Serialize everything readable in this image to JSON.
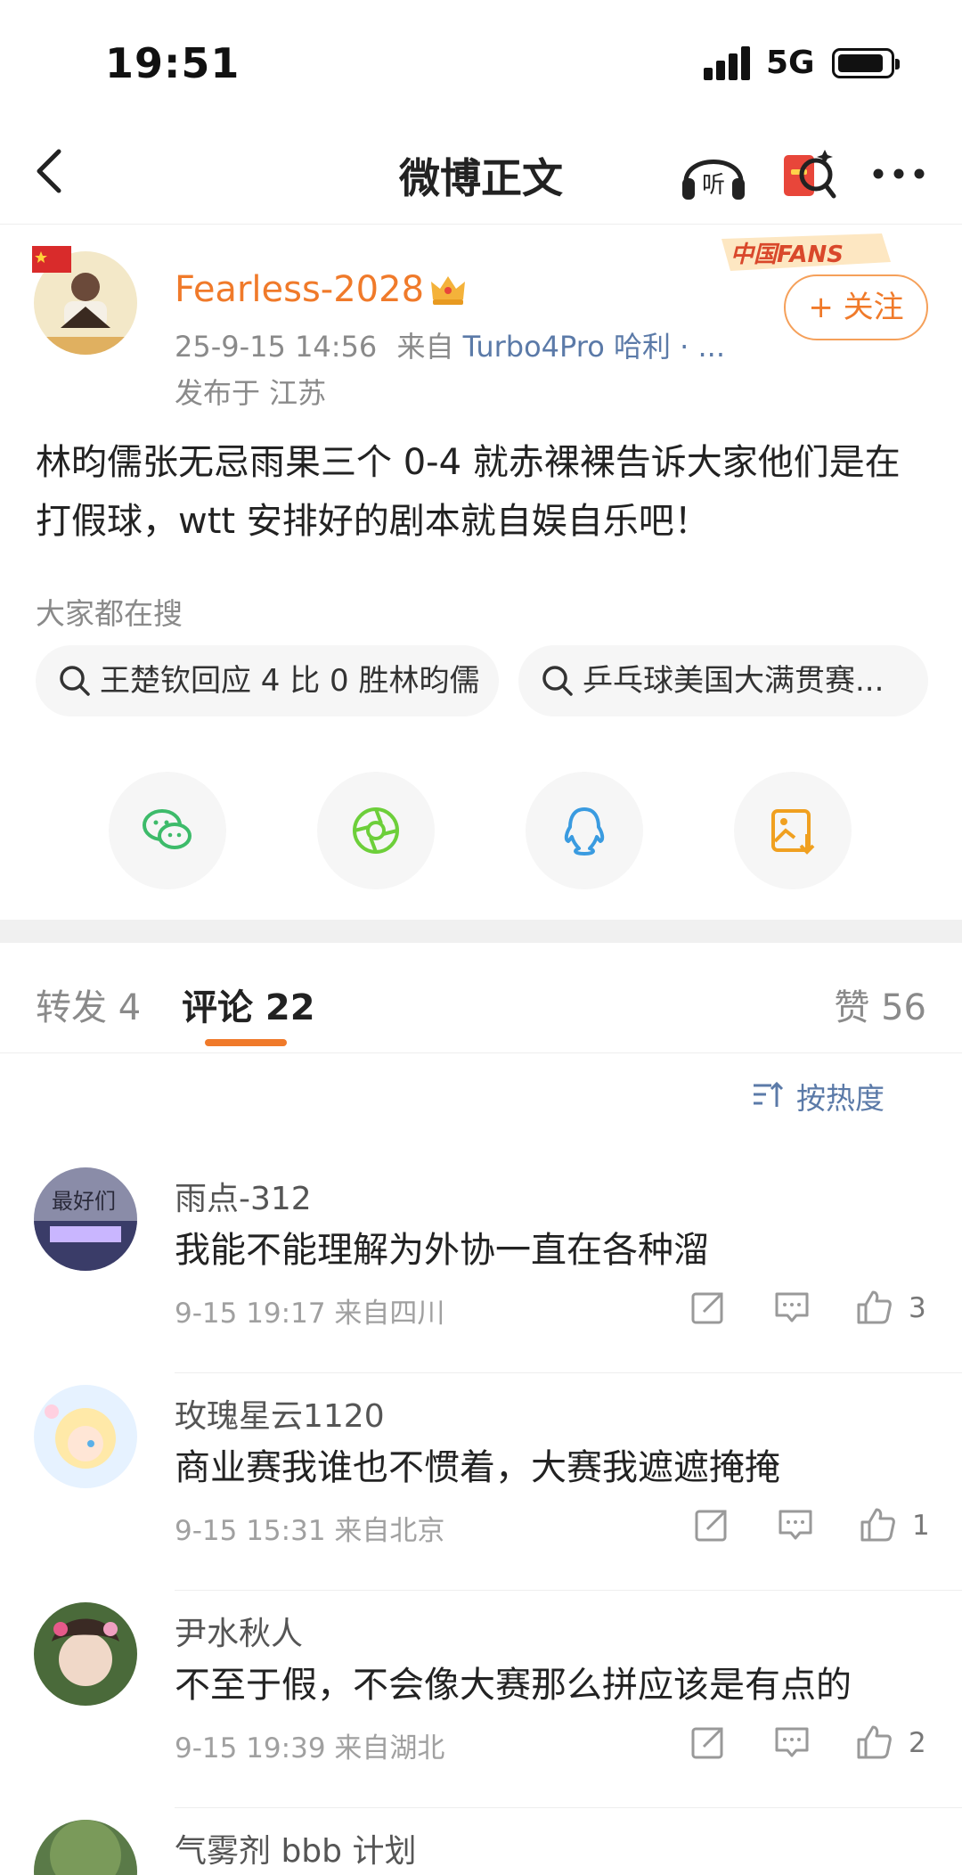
{
  "status_bar": {
    "time": "19:51",
    "network": "5G"
  },
  "nav": {
    "title": "微博正文"
  },
  "post": {
    "username": "Fearless-2028",
    "timestamp": "25-9-15 14:56",
    "source_prefix": "来自",
    "source": "Turbo4Pro 哈利 · ...",
    "location": "发布于 江苏",
    "follow_label": "+ 关注",
    "badge_text": "中国FANS",
    "text": "林昀儒张无忌雨果三个 0-4 就赤裸裸告诉大家他们是在打假球，wtt 安排好的剧本就自娱自乐吧！"
  },
  "hot_search": {
    "label": "大家都在搜",
    "chips": [
      "王楚钦回应 4 比 0 胜林昀儒",
      "乒乓球美国大满贯赛..."
    ]
  },
  "share_icons": [
    "wechat-icon",
    "moments-icon",
    "qq-icon",
    "save-image-icon"
  ],
  "tabs": {
    "repost": "转发 4",
    "comment": "评论 22",
    "like": "赞 56"
  },
  "sort_label": "按热度",
  "comments": [
    {
      "name": "雨点-312",
      "text": "我能不能理解为外协一直在各种溜",
      "meta": "9-15 19:17 来自四川",
      "likes": "3"
    },
    {
      "name": "玫瑰星云1120",
      "text": "商业赛我谁也不惯着，大赛我遮遮掩掩",
      "meta": "9-15 15:31 来自北京",
      "likes": "1"
    },
    {
      "name": "尹水秋人",
      "text": "不至于假，不会像大赛那么拼应该是有点的",
      "meta": "9-15 19:39 来自湖北",
      "likes": "2"
    },
    {
      "name": "气雾剂 bbb 计划",
      "text": "",
      "meta": "",
      "likes": ""
    }
  ],
  "colors": {
    "accent": "#f07a2a",
    "link": "#5b7aa8",
    "gray": "#8a8a8a"
  }
}
